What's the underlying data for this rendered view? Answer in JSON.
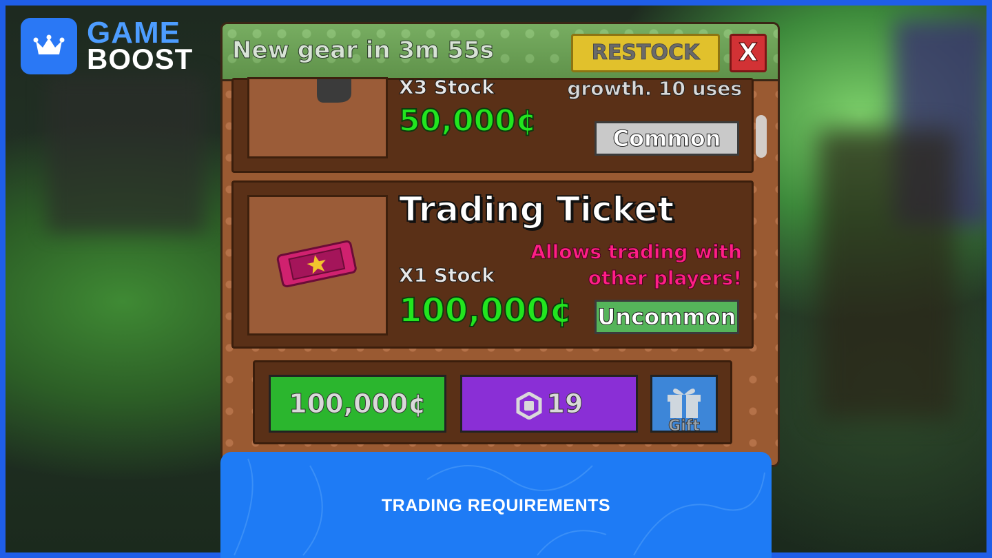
{
  "brand": {
    "line1": "GAME",
    "line2": "BOOST"
  },
  "shop": {
    "timer": "New gear in 3m 55s",
    "restock_label": "RESTOCK",
    "close_label": "X",
    "items": [
      {
        "stock": "X3 Stock",
        "price": "50,000¢",
        "description": "growth. 10 uses",
        "rarity": "Common",
        "rarity_color": "#c9c9c9"
      },
      {
        "name": "Trading Ticket",
        "stock": "X1 Stock",
        "price": "100,000¢",
        "description_line1": "Allows trading with",
        "description_line2": "other players!",
        "description_color": "#ff1f86",
        "rarity": "Uncommon",
        "rarity_color": "#55b45a",
        "icon": "ticket-icon"
      }
    ],
    "buy_cash_label": "100,000¢",
    "buy_robux_label": "19",
    "gift_label": "Gift"
  },
  "banner": {
    "text": "TRADING REQUIREMENTS"
  }
}
